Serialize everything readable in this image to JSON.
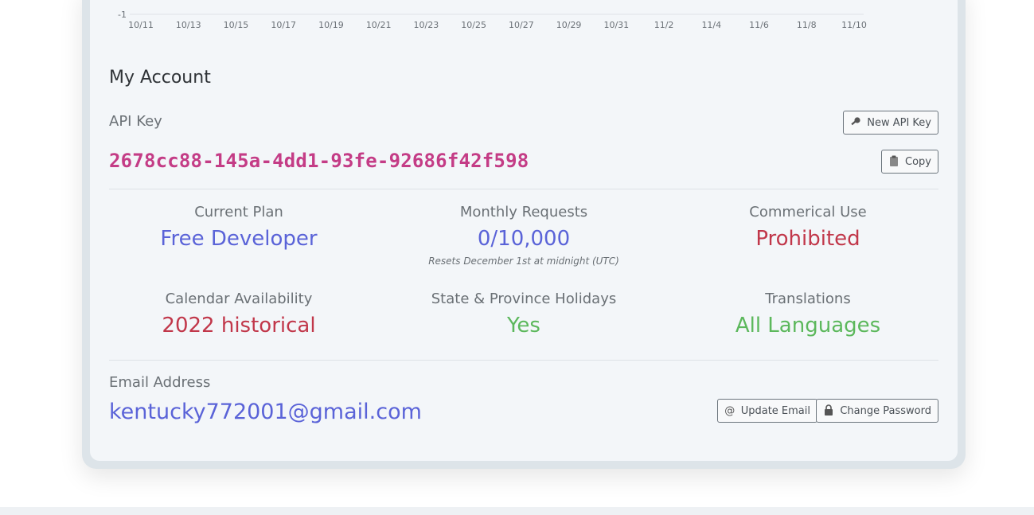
{
  "chart_data": {
    "type": "line",
    "x_tick_labels": [
      "10/11",
      "10/13",
      "10/15",
      "10/17",
      "10/19",
      "10/21",
      "10/23",
      "10/25",
      "10/27",
      "10/29",
      "10/31",
      "11/2",
      "11/4",
      "11/6",
      "11/8",
      "11/10"
    ],
    "y_tick_labels": [
      "-1"
    ],
    "grid": true
  },
  "account": {
    "title": "My Account",
    "api_key_label": "API Key",
    "api_key": "2678cc88-145a-4dd1-93fe-92686f42f598",
    "new_api_key_button": "New API Key",
    "copy_button": "Copy",
    "stats": {
      "current_plan_label": "Current Plan",
      "current_plan_value": "Free Developer",
      "monthly_requests_label": "Monthly Requests",
      "monthly_requests_value": "0/10,000",
      "monthly_requests_note": "Resets December 1st at midnight (UTC)",
      "commercial_use_label": "Commerical Use",
      "commercial_use_value": "Prohibited",
      "calendar_label": "Calendar Availability",
      "calendar_value": "2022 historical",
      "state_holidays_label": "State & Province Holidays",
      "state_holidays_value": "Yes",
      "translations_label": "Translations",
      "translations_value": "All Languages"
    },
    "email_label": "Email Address",
    "email_value": "kentucky772001@gmail.com",
    "update_email_button": "Update Email",
    "change_password_button": "Change Password"
  },
  "colors": {
    "api_key": "#c43c86",
    "blue_value": "#5a63d8",
    "red_value": "#c1374a",
    "green_value": "#5cb85c"
  },
  "icons": {
    "new_key": "key-icon",
    "copy": "clipboard-icon",
    "email": "at-icon",
    "password": "lock-icon"
  }
}
